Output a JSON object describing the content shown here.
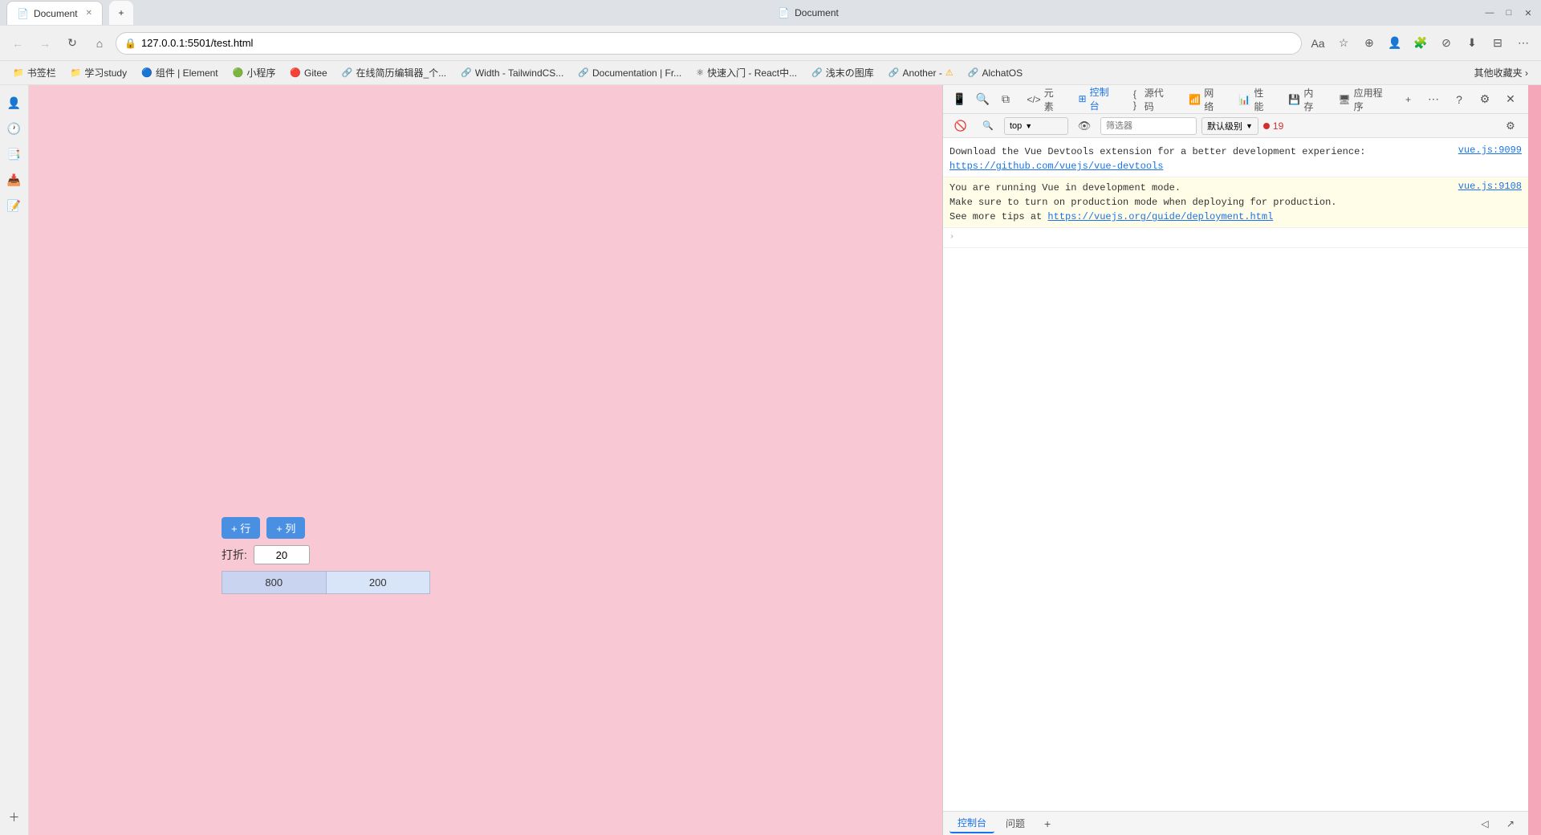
{
  "browser": {
    "title": "Document",
    "url": "127.0.0.1:5501/test.html",
    "tabs": [
      {
        "label": "Document",
        "icon": "📄",
        "active": true
      }
    ],
    "bookmarks": [
      {
        "label": "书签栏",
        "icon": "📁"
      },
      {
        "label": "学习study",
        "icon": "📁"
      },
      {
        "label": "组件 | Element",
        "icon": "🔵"
      },
      {
        "label": "小程序",
        "icon": "🟢"
      },
      {
        "label": "Gitee",
        "icon": "🔴"
      },
      {
        "label": "在线简历编辑器_个...",
        "icon": "🔗"
      },
      {
        "label": "Width - TailwindCS...",
        "icon": "🔗"
      },
      {
        "label": "Documentation | Fr...",
        "icon": "🔗"
      },
      {
        "label": "快速入门 - React中...",
        "icon": "⚛"
      },
      {
        "label": "浅末の图库",
        "icon": "🔗"
      },
      {
        "label": "Another -",
        "icon": "🔗"
      },
      {
        "label": "AlchatOS",
        "icon": "🔗"
      }
    ],
    "bookmarks_more": "其他收藏夹"
  },
  "page": {
    "background": "#f8c8d4",
    "btn_add_row": "+ 行",
    "btn_add_col": "+ 列",
    "discount_label": "打折:",
    "discount_value": "20",
    "table_row": [
      {
        "col1": "800",
        "col2": "200"
      }
    ]
  },
  "devtools": {
    "tabs": [
      {
        "label": "元素",
        "icon": "</>"
      },
      {
        "label": "控制台",
        "active": true
      },
      {
        "label": "源代码"
      },
      {
        "label": "网络"
      },
      {
        "label": "性能"
      },
      {
        "label": "内存"
      },
      {
        "label": "应用程序"
      }
    ],
    "console_filter_placeholder": "筛选器",
    "level_label": "默认级别",
    "error_count": "19",
    "console_messages": [
      {
        "type": "info",
        "text": "Download the Vue Devtools extension for a better development experience:",
        "link": "https://github.com/vuejs/vue-devtools",
        "file": "vue.js:9099"
      },
      {
        "type": "warn",
        "text": "You are running Vue in development mode.\nMake sure to turn on production mode when deploying for production.\nSee more tips at ",
        "link": "https://vuejs.org/guide/deployment.html",
        "file": "vue.js:9108"
      }
    ],
    "bottom_tabs": [
      {
        "label": "控制台",
        "active": true
      },
      {
        "label": "问题"
      }
    ],
    "add_btn": "+"
  },
  "sidebar_icons": [
    {
      "name": "profile-icon",
      "symbol": "👤"
    },
    {
      "name": "history-icon",
      "symbol": "🕐"
    },
    {
      "name": "collections-icon",
      "symbol": "📑"
    },
    {
      "name": "downloads-icon",
      "symbol": "📥"
    },
    {
      "name": "notes-icon",
      "symbol": "📝"
    }
  ],
  "window_controls": {
    "minimize": "—",
    "maximize": "□",
    "close": "✕"
  }
}
